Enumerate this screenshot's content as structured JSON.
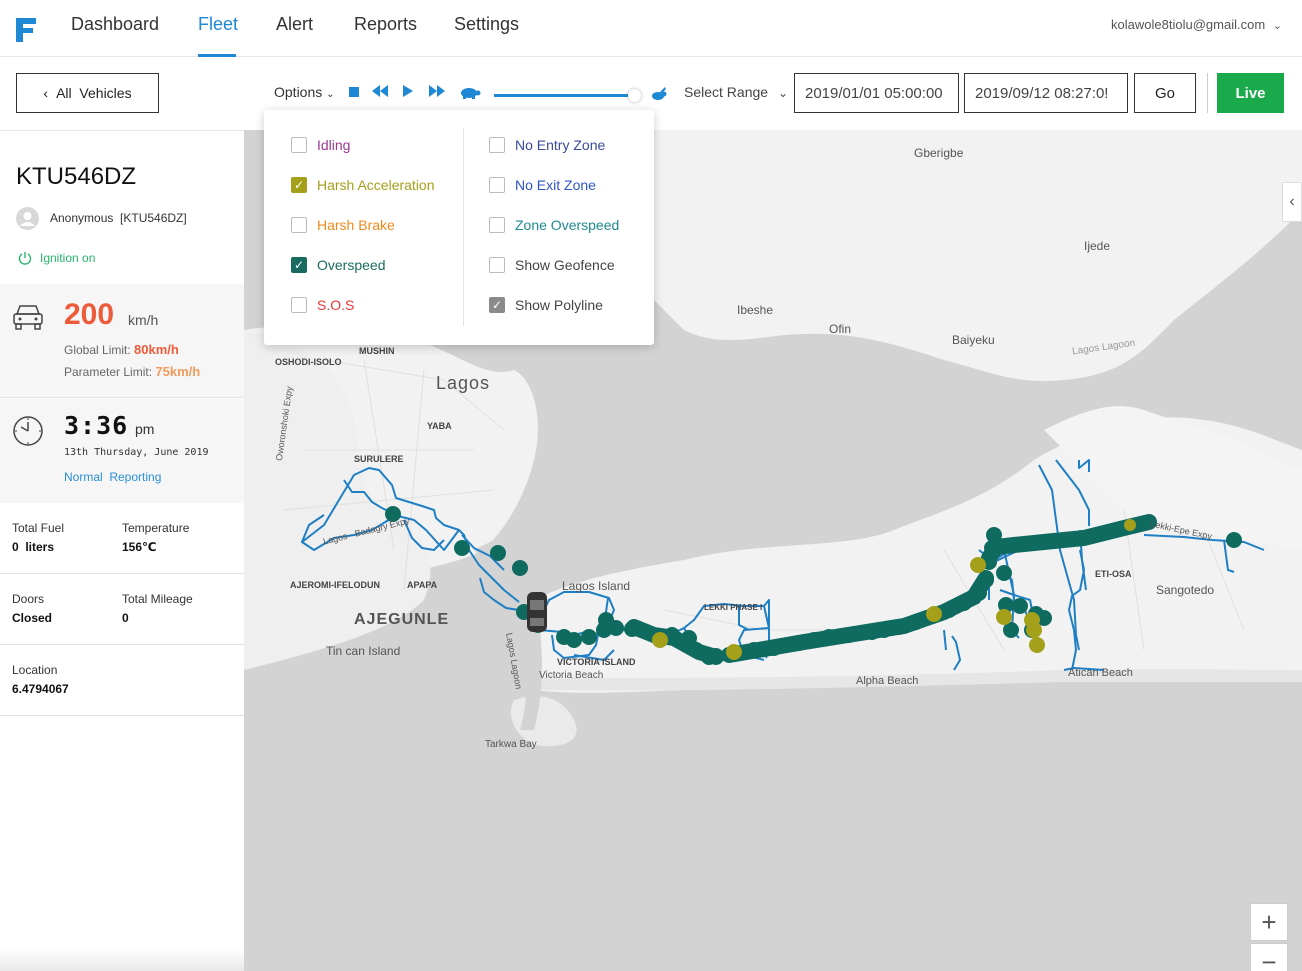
{
  "nav": {
    "items": [
      "Dashboard",
      "Fleet",
      "Alert",
      "Reports",
      "Settings"
    ],
    "active": "Fleet",
    "user_email": "kolawole8tiolu@gmail.com"
  },
  "toolbar": {
    "all_vehicles_label": "All  Vehicles",
    "options_label": "Options",
    "select_range_label": "Select Range",
    "start_date": "2019/01/01 05:00:00",
    "end_date": "2019/09/12 08:27:0!",
    "go_label": "Go",
    "live_label": "Live",
    "playback_speed": 0.95
  },
  "options_menu": {
    "left": [
      {
        "label": "Idling",
        "checked": false,
        "color": "#9b3a8f",
        "checkbox_color": ""
      },
      {
        "label": "Harsh Acceleration",
        "checked": true,
        "color": "#a5a01a",
        "checkbox_color": "#a5a01a"
      },
      {
        "label": "Harsh Brake",
        "checked": false,
        "color": "#f08a1c",
        "checkbox_color": ""
      },
      {
        "label": "Overspeed",
        "checked": true,
        "color": "#1a6b5f",
        "checkbox_color": "#1a6b5f"
      },
      {
        "label": "S.O.S",
        "checked": false,
        "color": "#e53935",
        "checkbox_color": ""
      }
    ],
    "right": [
      {
        "label": "No Entry Zone",
        "checked": false,
        "color": "#3a4a9b",
        "checkbox_color": ""
      },
      {
        "label": "No Exit Zone",
        "checked": false,
        "color": "#2f55c9",
        "checkbox_color": ""
      },
      {
        "label": "Zone Overspeed",
        "checked": false,
        "color": "#1e8a8f",
        "checkbox_color": ""
      },
      {
        "label": "Show Geofence",
        "checked": false,
        "color": "#444444",
        "checkbox_color": ""
      },
      {
        "label": "Show Polyline",
        "checked": true,
        "color": "#444444",
        "checkbox_color": "#8a8a8a"
      }
    ]
  },
  "vehicle": {
    "plate": "KTU546DZ",
    "owner": "Anonymous  [KTU546DZ]",
    "ignition": "Ignition on",
    "speed": "200",
    "speed_unit": "km/h",
    "global_limit_label": "Global Limit:",
    "global_limit": "80km/h",
    "parameter_limit_label": "Parameter Limit:",
    "parameter_limit": "75km/h",
    "time": "3:36",
    "ampm": "pm",
    "date": "13th Thursday, June 2019",
    "reporting": "Normal  Reporting",
    "total_fuel_label": "Total Fuel",
    "total_fuel": "0  liters",
    "temperature_label": "Temperature",
    "temperature": "156℃",
    "doors_label": "Doors",
    "doors": "Closed",
    "mileage_label": "Total Mileage",
    "mileage": "0",
    "location_label": "Location",
    "location": "6.4794067"
  },
  "map": {
    "labels": {
      "gberigbe": "Gberigbe",
      "ijede": "Ijede",
      "ibeshe": "Ibeshe",
      "ofin": "Ofin",
      "baiyeku": "Baiyeku",
      "lagos_lagoon_ne": "Lagos Lagoon",
      "oshodi": "OSHODI-ISOLO",
      "mushin": "MUSHIN",
      "lagos": "Lagos",
      "yaba": "YABA",
      "surulere": "SURULERE",
      "expy": "Oworonshoki Expy",
      "lagos_badagry": "Lagos - Badagry Expy",
      "ajeromi": "AJEROMI-IFELODUN",
      "apapa": "APAPA",
      "lagos_island": "Lagos Island",
      "ajegunle": "AJEGUNLE",
      "tin_can": "Tin can Island",
      "lagos_lagoon_s": "Lagos Lagoon",
      "victoria_island": "VICTORIA ISLAND",
      "victoria_beach": "Victoria Beach",
      "tarkwa": "Tarkwa Bay",
      "lekki": "LEKKI PHASE I",
      "alpha_beach": "Alpha Beach",
      "eti_osa": "ETI-OSA",
      "sangotedo": "Sangotedo",
      "atican": "Atican Beach",
      "epe_expy": "Lekki-Epe Expy"
    },
    "zoom_in": "+",
    "zoom_out": "−",
    "route_color": "#1f7fc4",
    "overspeed_color": "#0f6b60",
    "harsh_accel_color": "#a5a01a"
  }
}
